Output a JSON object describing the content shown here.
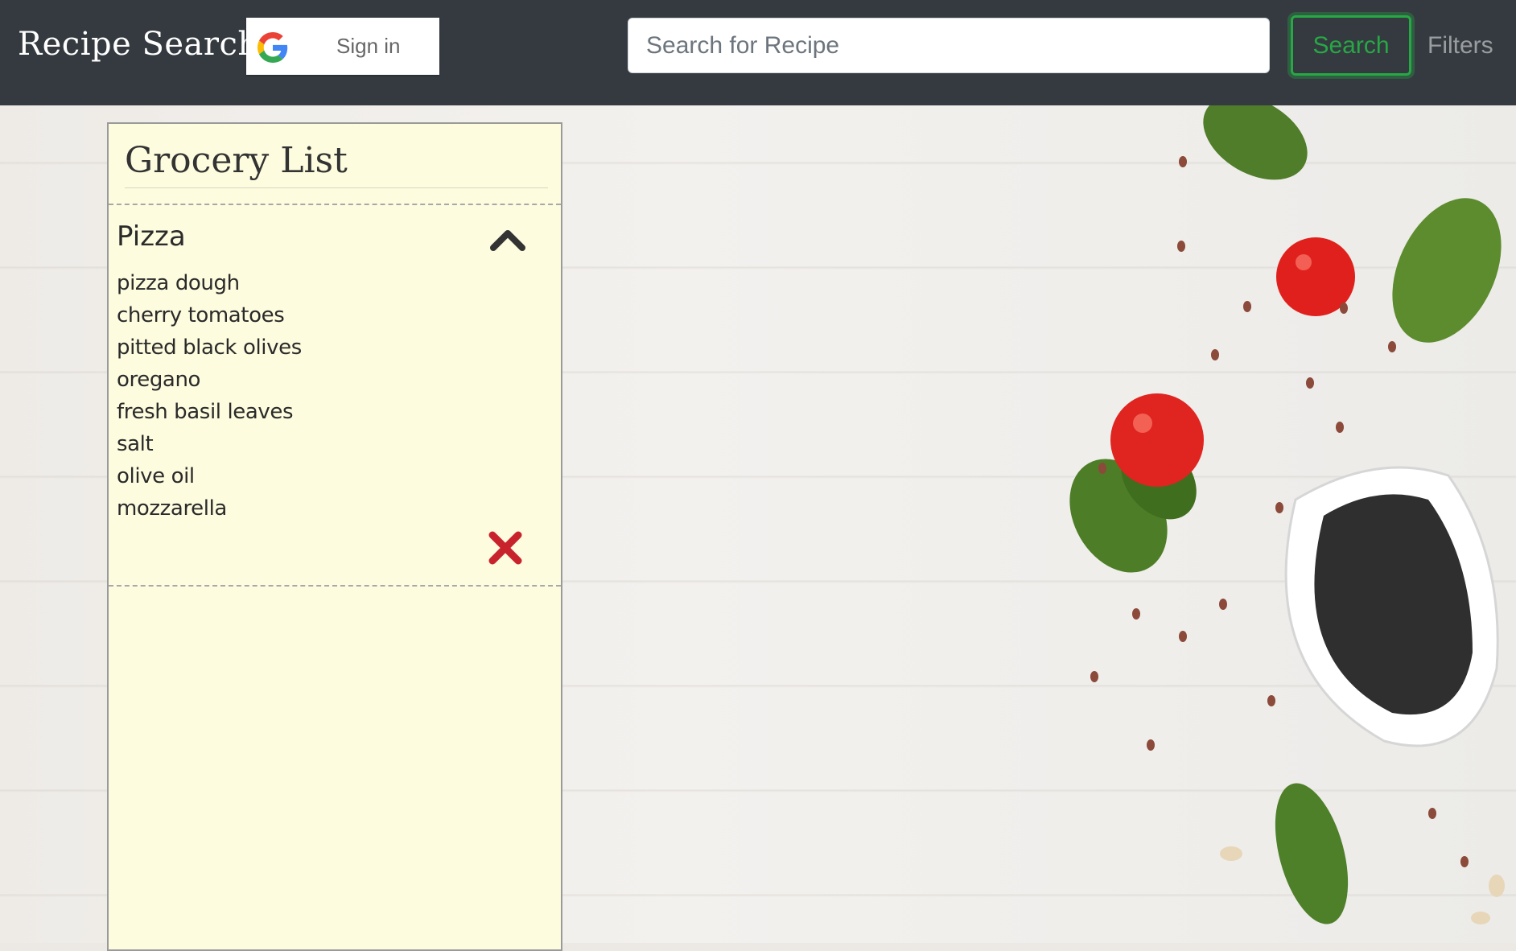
{
  "navbar": {
    "brand": "Recipe Search",
    "sign_in_label": "Sign in",
    "search_placeholder": "Search for Recipe",
    "search_value": "",
    "search_button_label": "Search",
    "filters_label": "Filters",
    "accent_color": "#28a745",
    "background_color": "#343a40"
  },
  "grocery_list": {
    "title": "Grocery List",
    "sections": [
      {
        "name": "Pizza",
        "expanded": true,
        "items": [
          "pizza dough",
          "cherry tomatoes",
          "pitted black olives",
          "oregano",
          "fresh basil leaves",
          "salt",
          "olive oil",
          "mozzarella"
        ],
        "toggle_icon": "chevron-up-icon",
        "remove_icon": "close-icon",
        "remove_color": "#c8232c"
      }
    ],
    "panel_color": "#fdfcdf"
  }
}
